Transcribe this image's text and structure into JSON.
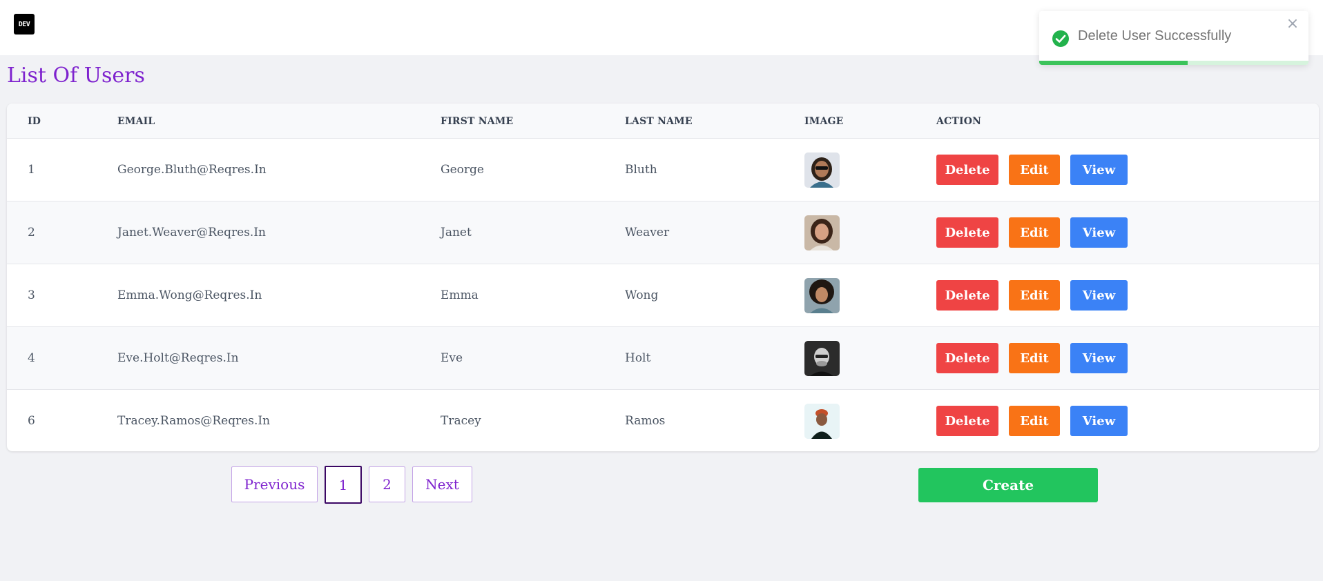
{
  "header": {
    "logo_text": "DEV"
  },
  "page": {
    "title": "List Of Users"
  },
  "table": {
    "columns": [
      "ID",
      "EMAIL",
      "FIRST NAME",
      "LAST NAME",
      "IMAGE",
      "ACTION"
    ],
    "rows": [
      {
        "id": "1",
        "email": "George.Bluth@Reqres.In",
        "first_name": "George",
        "last_name": "Bluth",
        "avatar": "avatar-george"
      },
      {
        "id": "2",
        "email": "Janet.Weaver@Reqres.In",
        "first_name": "Janet",
        "last_name": "Weaver",
        "avatar": "avatar-janet"
      },
      {
        "id": "3",
        "email": "Emma.Wong@Reqres.In",
        "first_name": "Emma",
        "last_name": "Wong",
        "avatar": "avatar-emma"
      },
      {
        "id": "4",
        "email": "Eve.Holt@Reqres.In",
        "first_name": "Eve",
        "last_name": "Holt",
        "avatar": "avatar-eve"
      },
      {
        "id": "6",
        "email": "Tracey.Ramos@Reqres.In",
        "first_name": "Tracey",
        "last_name": "Ramos",
        "avatar": "avatar-tracey"
      }
    ],
    "actions": {
      "delete_label": "Delete",
      "edit_label": "Edit",
      "view_label": "View"
    }
  },
  "pagination": {
    "previous_label": "Previous",
    "pages": [
      "1",
      "2"
    ],
    "current_page": "1",
    "next_label": "Next"
  },
  "create_label": "Create",
  "toast": {
    "message": "Delete User Successfully",
    "close_glyph": "×",
    "icon": "check-circle-icon",
    "progress": 0.55
  },
  "colors": {
    "accent": "#7e22ce",
    "delete": "#ef4444",
    "edit": "#f97316",
    "view": "#3b82f6",
    "create": "#22c55e",
    "success": "#3cc35a"
  }
}
